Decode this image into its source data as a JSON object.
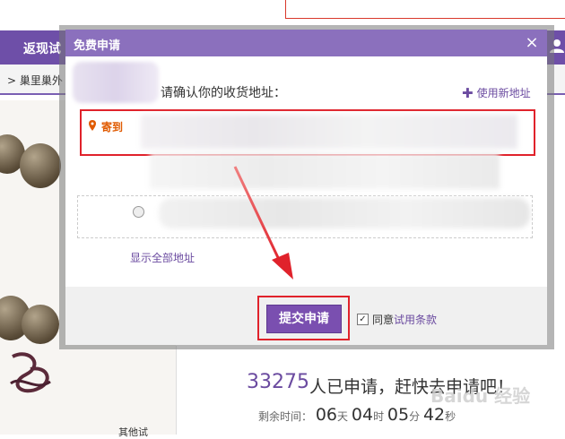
{
  "background": {
    "nav_item": "返现试",
    "breadcrumb": "> 巢里巢外",
    "apply_count": "33275",
    "apply_text": "人已申请，赶快去申请吧！",
    "timer_label": "剩余时间：",
    "timer_days": "06",
    "timer_days_unit": "天",
    "timer_hours": "04",
    "timer_hours_unit": "时",
    "timer_minutes": "05",
    "timer_minutes_unit": "分",
    "timer_seconds": "42",
    "timer_seconds_unit": "秒",
    "small_tag": "其他试",
    "watermark": "Baidu 经验"
  },
  "dialog": {
    "title": "免费申请",
    "close": "×",
    "confirm_label": "请确认你的收货地址：",
    "new_address": "使用新地址",
    "selected_address_tag": "寄到",
    "show_all": "显示全部地址",
    "submit": "提交申请",
    "agree_prefix": "同意",
    "agree_link": "试用条款",
    "agree_checked": "✓"
  },
  "colors": {
    "accent": "#7a4fb0",
    "highlight": "#e0222b",
    "header": "#8b70bd"
  }
}
